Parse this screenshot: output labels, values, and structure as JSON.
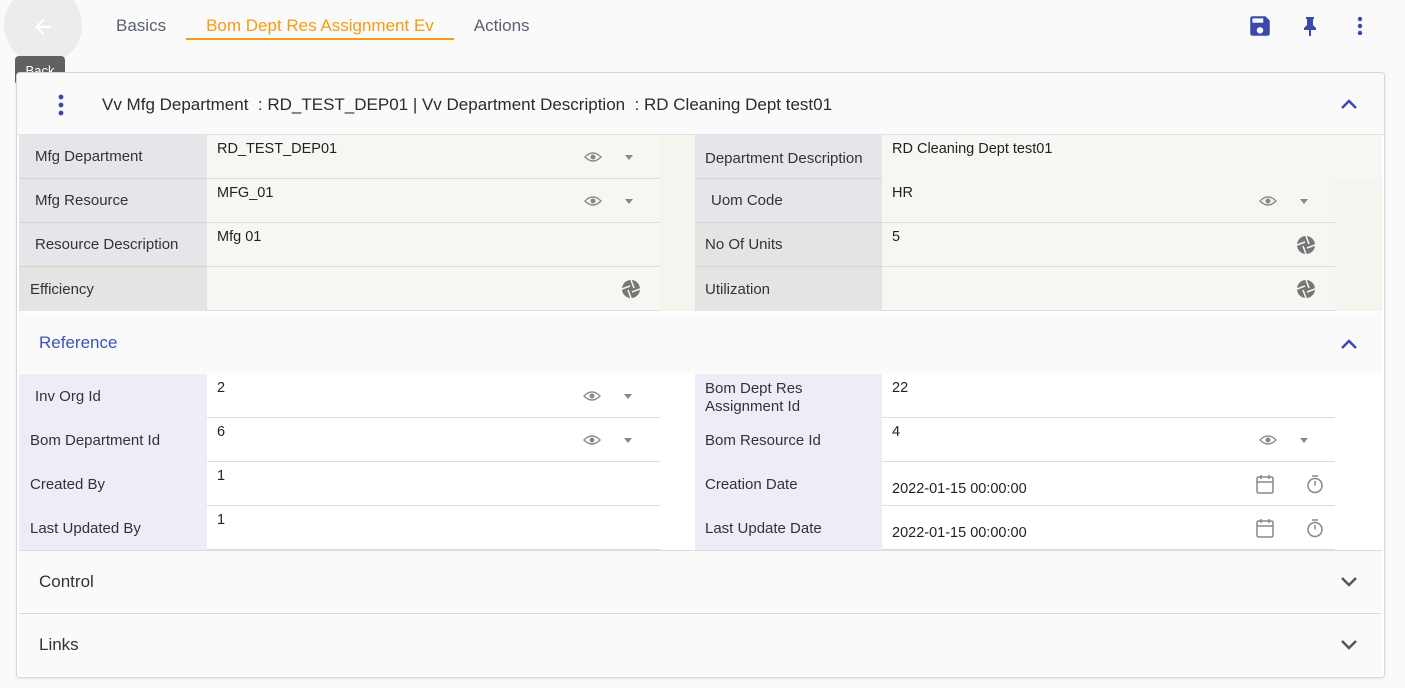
{
  "nav": {
    "back_tooltip": "Back",
    "tabs": [
      "Basics",
      "Bom Dept Res Assignment Ev",
      "Actions"
    ],
    "active_tab": "Bom Dept Res Assignment Ev"
  },
  "header": {
    "title": "Vv Mfg Department  : RD_TEST_DEP01 | Vv Department Description  : RD Cleaning Dept test01"
  },
  "main_fields": {
    "mfg_department": {
      "label": "Mfg Department",
      "value": "RD_TEST_DEP01"
    },
    "department_description": {
      "label": "Department Description",
      "value": "RD Cleaning Dept test01"
    },
    "mfg_resource": {
      "label": "Mfg Resource",
      "value": "MFG_01"
    },
    "uom_code": {
      "label": "Uom Code",
      "value": "HR"
    },
    "resource_description": {
      "label": "Resource Description",
      "value": "Mfg 01"
    },
    "no_of_units": {
      "label": "No Of Units",
      "value": "5"
    },
    "efficiency": {
      "label": "Efficiency",
      "value": ""
    },
    "utilization": {
      "label": "Utilization",
      "value": ""
    }
  },
  "reference": {
    "title": "Reference",
    "inv_org_id": {
      "label": "Inv Org Id",
      "value": "2"
    },
    "bom_dept_res_assignment_id": {
      "label": "Bom Dept Res Assignment Id",
      "value": "22"
    },
    "bom_department_id": {
      "label": "Bom Department Id",
      "value": "6"
    },
    "bom_resource_id": {
      "label": "Bom Resource Id",
      "value": "4"
    },
    "created_by": {
      "label": "Created By",
      "value": "1"
    },
    "creation_date": {
      "label": "Creation Date",
      "value": "2022-01-15 00:00:00"
    },
    "last_updated_by": {
      "label": "Last Updated By",
      "value": "1"
    },
    "last_update_date": {
      "label": "Last Update Date",
      "value": "2022-01-15 00:00:00"
    }
  },
  "sections": {
    "control": "Control",
    "links": "Links"
  },
  "colors": {
    "accent": "#f39c12",
    "primary": "#3f51b5",
    "icon_blue": "#3949ab"
  },
  "icons": [
    "arrow-left-icon",
    "save-icon",
    "pin-icon",
    "more-vert-icon",
    "eye-icon",
    "caret-down-icon",
    "aperture-icon",
    "calendar-icon",
    "timer-icon",
    "chevron-up-icon",
    "chevron-down-icon"
  ]
}
